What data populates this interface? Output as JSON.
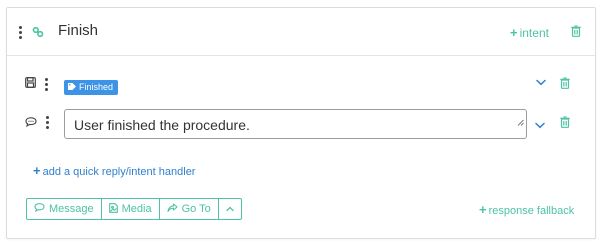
{
  "block": {
    "title": "Finish",
    "add_intent_label": "intent"
  },
  "message": {
    "tag": "Finished",
    "text": "User finished the procedure."
  },
  "add_handler_label": "add a quick reply/intent handler",
  "toolbar": {
    "message_label": "Message",
    "media_label": "Media",
    "goto_label": "Go To"
  },
  "response_fallback_label": "response fallback",
  "colors": {
    "accent": "#4dc3a3",
    "link": "#2f7fcf",
    "badge": "#3d93e6"
  },
  "icons": [
    "more-vert-icon",
    "link-icon",
    "trash-icon",
    "save-icon",
    "chevron-down-icon",
    "chat-icon",
    "tag-icon",
    "plus-icon",
    "image-icon",
    "share-icon",
    "chevron-up-icon"
  ]
}
